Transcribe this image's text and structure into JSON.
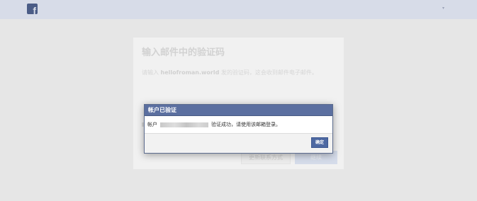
{
  "topbar": {
    "logo_letter": "f",
    "menu_caret": "▾"
  },
  "card": {
    "title": "输入邮件中的验证码",
    "desc_prefix": "请输入",
    "desc_email": "hellofroman.world",
    "desc_suffix": "发的验证码，这会收到邮件电子邮件。",
    "secondary_button": "更新联系方式",
    "primary_button": "继续"
  },
  "dialog": {
    "title": "帐户已验证",
    "body_prefix": "帐户",
    "body_suffix": "验证成功，请使用该邮箱登录。",
    "ok_button": "确定"
  }
}
